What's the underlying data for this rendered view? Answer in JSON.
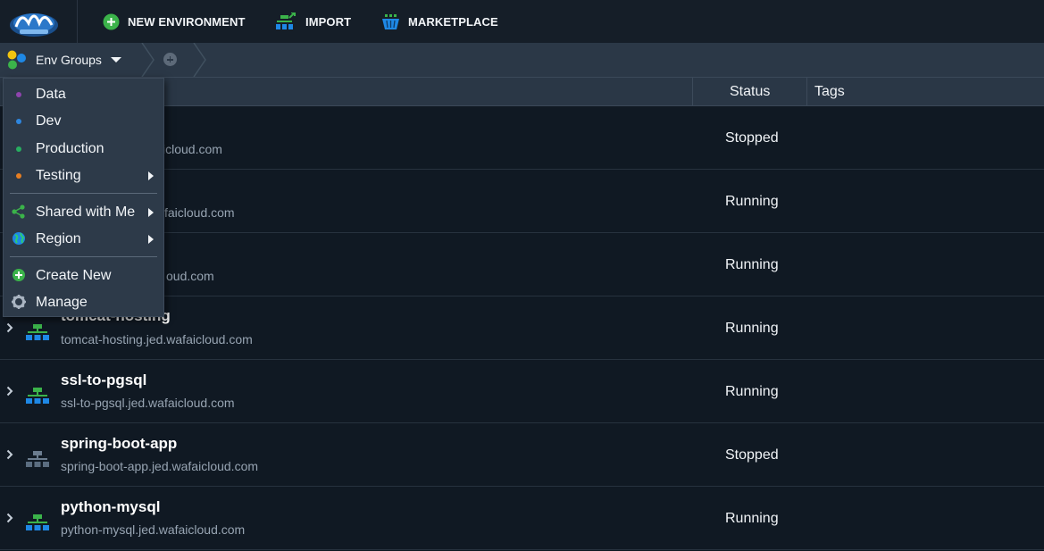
{
  "toolbar": {
    "new_environment": "NEW ENVIRONMENT",
    "import": "IMPORT",
    "marketplace": "MARKETPLACE"
  },
  "breadcrumb": {
    "group_label": "Env Groups"
  },
  "table": {
    "columns": {
      "status": "Status",
      "tags": "Tags"
    },
    "rows": [
      {
        "name": "",
        "domain": "icloud.com",
        "status": "Stopped",
        "icon_color": "green"
      },
      {
        "name": "",
        "domain": "faicloud.com",
        "status": "Running",
        "icon_color": "green"
      },
      {
        "name": "",
        "domain": "oud.com",
        "status": "Running",
        "icon_color": "green"
      },
      {
        "name": "tomcat-hosting",
        "domain": "tomcat-hosting.jed.wafaicloud.com",
        "status": "Running",
        "icon_color": "green"
      },
      {
        "name": "ssl-to-pgsql",
        "domain": "ssl-to-pgsql.jed.wafaicloud.com",
        "status": "Running",
        "icon_color": "green"
      },
      {
        "name": "spring-boot-app",
        "domain": "spring-boot-app.jed.wafaicloud.com",
        "status": "Stopped",
        "icon_color": "gray"
      },
      {
        "name": "python-mysql",
        "domain": "python-mysql.jed.wafaicloud.com",
        "status": "Running",
        "icon_color": "green"
      }
    ]
  },
  "menu": {
    "items": [
      {
        "label": "Data",
        "dot_color": "#8e44ad"
      },
      {
        "label": "Dev",
        "dot_color": "#2e86de"
      },
      {
        "label": "Production",
        "dot_color": "#27ae60"
      },
      {
        "label": "Testing",
        "dot_color": "#e67e22",
        "submenu": true
      },
      {
        "label": "Shared with Me",
        "icon": "share-icon",
        "submenu": true
      },
      {
        "label": "Region",
        "icon": "globe-icon",
        "submenu": true
      },
      {
        "label": "Create New",
        "icon": "plus-circle-icon"
      },
      {
        "label": "Manage",
        "icon": "gear-icon"
      }
    ]
  },
  "colors": {
    "accent_green": "#3bb34a",
    "accent_blue": "#1e88e5",
    "background": "#0f1822"
  }
}
